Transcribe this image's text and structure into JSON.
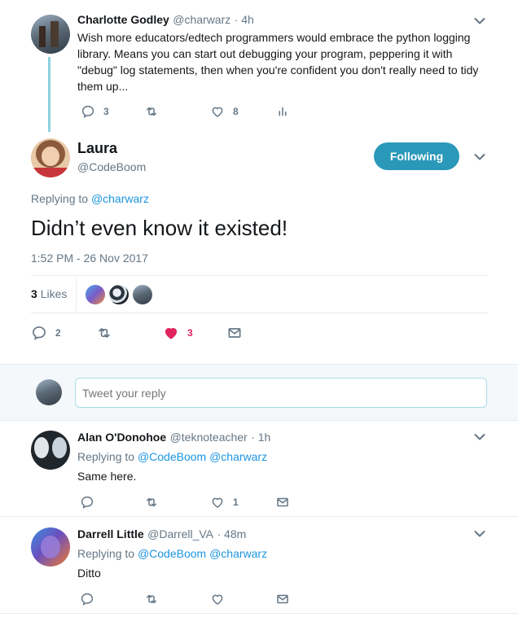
{
  "parent_tweet": {
    "name": "Charlotte Godley",
    "handle": "@charwarz",
    "time": "· 4h",
    "text": "Wish more educators/edtech programmers would embrace the python logging library. Means you can start out debugging your program, peppering it with \"debug\" log statements, then when you're confident you don't really need to tidy them up...",
    "reply_count": "3",
    "like_count": "8"
  },
  "main_tweet": {
    "name": "Laura",
    "handle": "@CodeBoom",
    "follow_label": "Following",
    "replying_prefix": "Replying to",
    "replying_to": "@charwarz",
    "text": "Didn’t even know it existed!",
    "timestamp": "1:52 PM - 26 Nov 2017",
    "likes_count": "3",
    "likes_label": "Likes",
    "reply_count": "2",
    "like_count": "3"
  },
  "reply_box": {
    "placeholder": "Tweet your reply"
  },
  "replies": [
    {
      "name": "Alan O'Donohoe",
      "handle": "@teknoteacher",
      "time": "· 1h",
      "replying_prefix": "Replying to",
      "replying_to": "@CodeBoom @charwarz",
      "text": "Same here.",
      "like_count": "1"
    },
    {
      "name": "Darrell Little",
      "handle": "@Darrell_VA",
      "time": "· 48m",
      "replying_prefix": "Replying to",
      "replying_to": "@CodeBoom @charwarz",
      "text": "Ditto"
    }
  ],
  "colors": {
    "accent": "#1c94a8",
    "link": "#1b95e0",
    "like_active": "#e0245e",
    "muted": "#657786",
    "thread_line": "#8cd3df"
  },
  "icons": {
    "reply": "reply-icon",
    "retweet": "retweet-icon",
    "like": "heart-icon",
    "dm": "envelope-icon",
    "analytics": "analytics-icon",
    "more": "chevron-down-icon"
  }
}
